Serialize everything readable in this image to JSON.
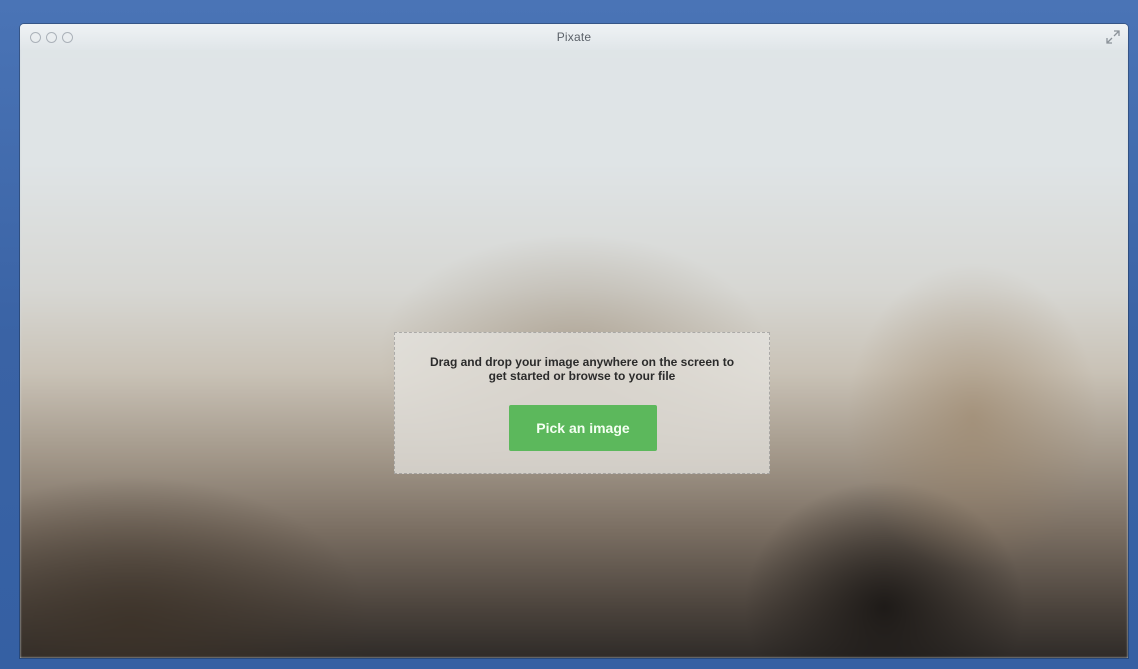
{
  "window": {
    "title": "Pixate",
    "traffic_lights": [
      "close",
      "minimize",
      "zoom"
    ],
    "fullscreen_icon": "expand-arrows-icon"
  },
  "dropzone": {
    "message": "Drag and drop your image anywhere on the screen to get started or browse to your file",
    "button_label": "Pick an image",
    "button_color": "#5cb85c"
  },
  "colors": {
    "desktop_border": "#3a64a6",
    "titlebar": "#e8ecef"
  }
}
